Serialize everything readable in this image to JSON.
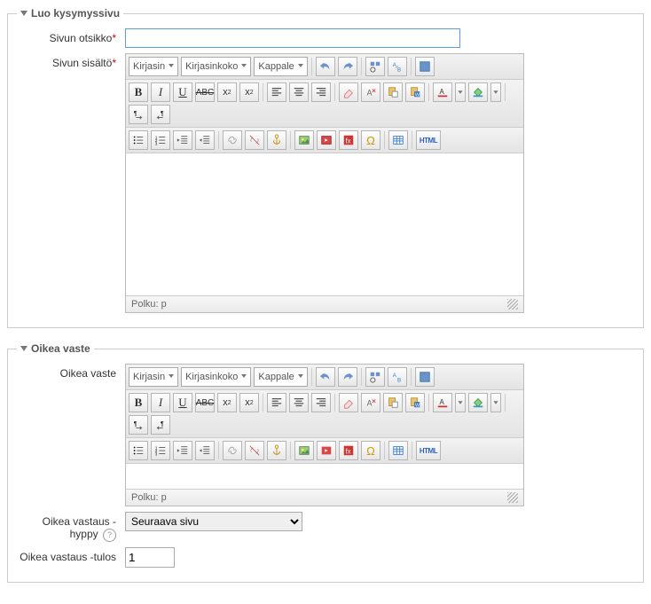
{
  "section1": {
    "legend": "Luo kysymyssivu",
    "title_label": "Sivun otsikko",
    "title_value": "",
    "content_label": "Sivun sisältö"
  },
  "section2": {
    "legend": "Oikea vaste",
    "response_label": "Oikea vaste",
    "jump_label": "Oikea vastaus -hyppy",
    "jump_value": "Seuraava sivu",
    "score_label": "Oikea vastaus -tulos",
    "score_value": "1"
  },
  "editor": {
    "font_family": "Kirjasin",
    "font_size": "Kirjasinkoko",
    "format": "Kappale",
    "path_label": "Polku: p",
    "html_label": "HTML",
    "omega": "Ω"
  }
}
